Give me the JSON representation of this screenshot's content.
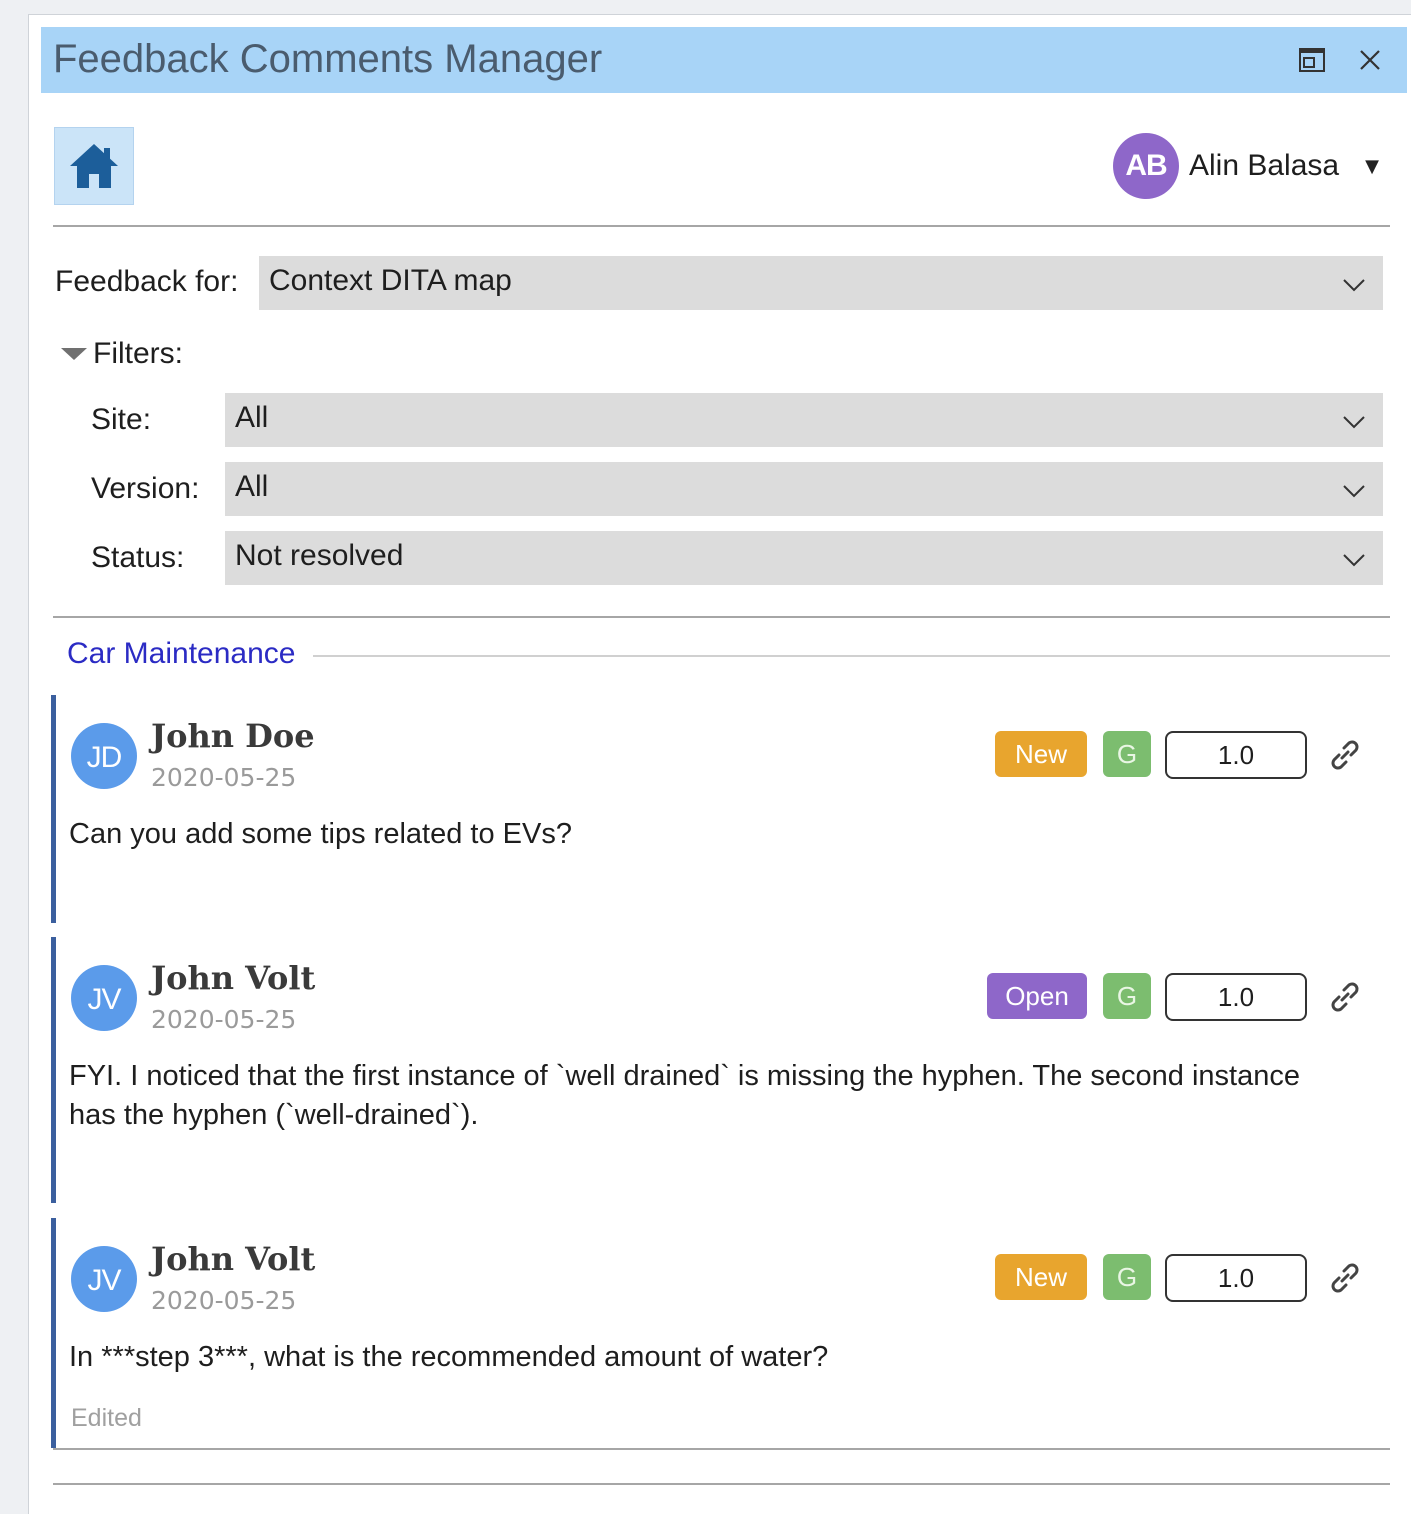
{
  "window": {
    "title": "Feedback Comments Manager"
  },
  "user": {
    "initials": "AB",
    "name": "Alin Balasa",
    "avatar_color": "#8e67c9"
  },
  "feedback_for": {
    "label": "Feedback for:",
    "value": "Context DITA map"
  },
  "filters": {
    "label": "Filters:",
    "site": {
      "label": "Site:",
      "value": "All"
    },
    "version": {
      "label": "Version:",
      "value": "All"
    },
    "status": {
      "label": "Status:",
      "value": "Not resolved"
    }
  },
  "section": {
    "title": "Car Maintenance"
  },
  "comments": [
    {
      "initials": "JD",
      "author": "John Doe",
      "date": "2020-05-25",
      "status": "New",
      "status_color": "#e8a52e",
      "g_label": "G",
      "version": "1.0",
      "text": "Can you add some tips related to EVs?",
      "edited": ""
    },
    {
      "initials": "JV",
      "author": "John Volt",
      "date": "2020-05-25",
      "status": "Open",
      "status_color": "#8e67c9",
      "g_label": "G",
      "version": "1.0",
      "text": "FYI. I noticed that the first instance of `well drained` is missing the hyphen. The second instance has the hyphen (`well-drained`).",
      "edited": ""
    },
    {
      "initials": "JV",
      "author": "John Volt",
      "date": "2020-05-25",
      "status": "New",
      "status_color": "#e8a52e",
      "g_label": "G",
      "version": "1.0",
      "text": "In ***step 3***, what is the recommended amount of water?",
      "edited": "Edited"
    }
  ],
  "colors": {
    "title_bar": "#a8d4f7",
    "comment_avatar": "#5b9bea",
    "accent_bar": "#3b5f9e",
    "section_link": "#2b2bc4"
  }
}
